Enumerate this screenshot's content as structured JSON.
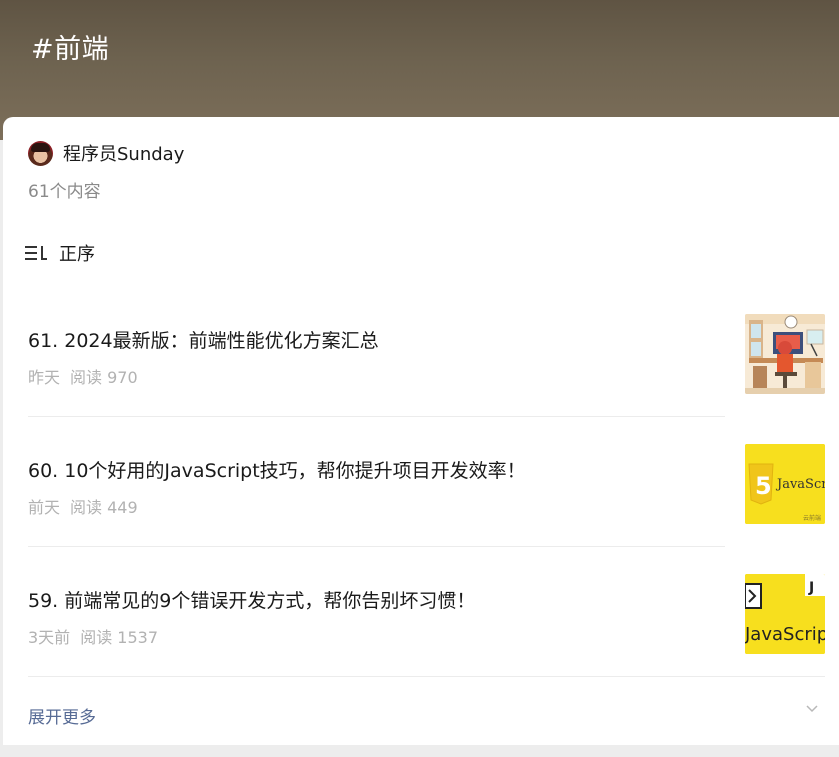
{
  "header": {
    "title": "#前端"
  },
  "author": {
    "name": "程序员Sunday",
    "count_label": "61个内容"
  },
  "sort": {
    "label": "正序"
  },
  "articles": [
    {
      "title": "61. 2024最新版：前端性能优化方案汇总",
      "date": "昨天",
      "reads": "阅读 970",
      "thumb": "office-illustration"
    },
    {
      "title": "60. 10个好用的JavaScript技巧，帮你提升项目开发效率！",
      "date": "前天",
      "reads": "阅读 449",
      "thumb_text": "JavaScri",
      "thumb_watermark": "云前端"
    },
    {
      "title": "59. 前端常见的9个错误开发方式，帮你告别坏习惯！",
      "date": "3天前",
      "reads": "阅读 1537",
      "thumb_text": "JavaScrip"
    }
  ],
  "footer": {
    "expand_label": "展开更多"
  },
  "colors": {
    "header_top": "#5f5443",
    "header_bottom": "#7d6f5a",
    "link": "#576b95",
    "meta": "#b2b2b2",
    "js_yellow": "#f7df1e"
  }
}
